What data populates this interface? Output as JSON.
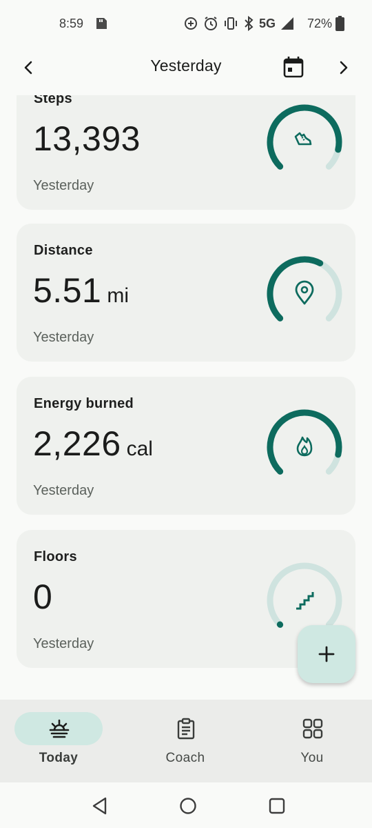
{
  "status_bar": {
    "time": "8:59",
    "network": "5G",
    "battery": "72%"
  },
  "header": {
    "title": "Yesterday",
    "prev_icon": "chevron-left-icon",
    "next_icon": "chevron-right-icon",
    "calendar_icon": "calendar-icon"
  },
  "cards": [
    {
      "title": "Steps",
      "value": "13,393",
      "unit": "",
      "subtitle": "Yesterday",
      "icon": "shoe-icon",
      "progress": 0.88
    },
    {
      "title": "Distance",
      "value": "5.51",
      "unit": "mi",
      "subtitle": "Yesterday",
      "icon": "location-pin-icon",
      "progress": 0.6
    },
    {
      "title": "Energy burned",
      "value": "2,226",
      "unit": "cal",
      "subtitle": "Yesterday",
      "icon": "flame-icon",
      "progress": 0.88
    },
    {
      "title": "Floors",
      "value": "0",
      "unit": "",
      "subtitle": "Yesterday",
      "icon": "stairs-icon",
      "progress": 0
    }
  ],
  "fab": {
    "icon": "plus-icon"
  },
  "bottom_nav": {
    "items": [
      {
        "label": "Today",
        "icon": "sunrise-icon",
        "active": true
      },
      {
        "label": "Coach",
        "icon": "clipboard-icon",
        "active": false
      },
      {
        "label": "You",
        "icon": "grid-icon",
        "active": false
      }
    ]
  },
  "colors": {
    "accent": "#0d6b5e",
    "track": "#cfe3df",
    "card_bg": "#eff1ee",
    "active_pill": "#cfe8e2"
  }
}
